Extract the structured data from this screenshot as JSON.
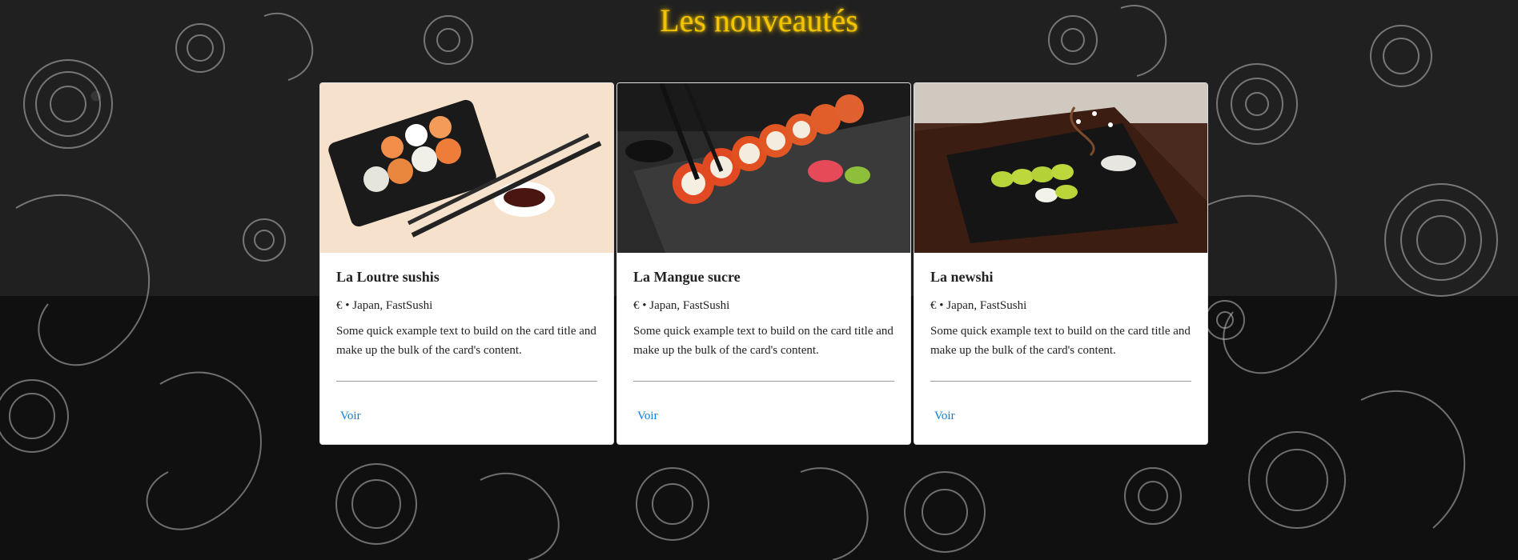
{
  "page": {
    "heading": "Les nouveautés",
    "heading_color": "#f5c400",
    "background_motif": "paisley-pattern"
  },
  "cards": [
    {
      "title": "La Loutre sushis",
      "meta": "€ • Japan, FastSushi",
      "text": "Some quick example text to build on the card title and make up the bulk of the card's content.",
      "link": "Voir",
      "image": "sushi-box-with-chopsticks-and-soy-sauce"
    },
    {
      "title": "La Mangue sucre",
      "meta": "€ • Japan, FastSushi",
      "text": "Some quick example text to build on the card title and make up the bulk of the card's content.",
      "link": "Voir",
      "image": "salmon-roe-rolls-on-slate"
    },
    {
      "title": "La newshi",
      "meta": "€ • Japan, FastSushi",
      "text": "Some quick example text to build on the card title and make up the bulk of the card's content.",
      "link": "Voir",
      "image": "avocado-rolls-on-black-board"
    }
  ],
  "colors": {
    "link": "#0b7de0",
    "card_bg": "#ffffff"
  }
}
